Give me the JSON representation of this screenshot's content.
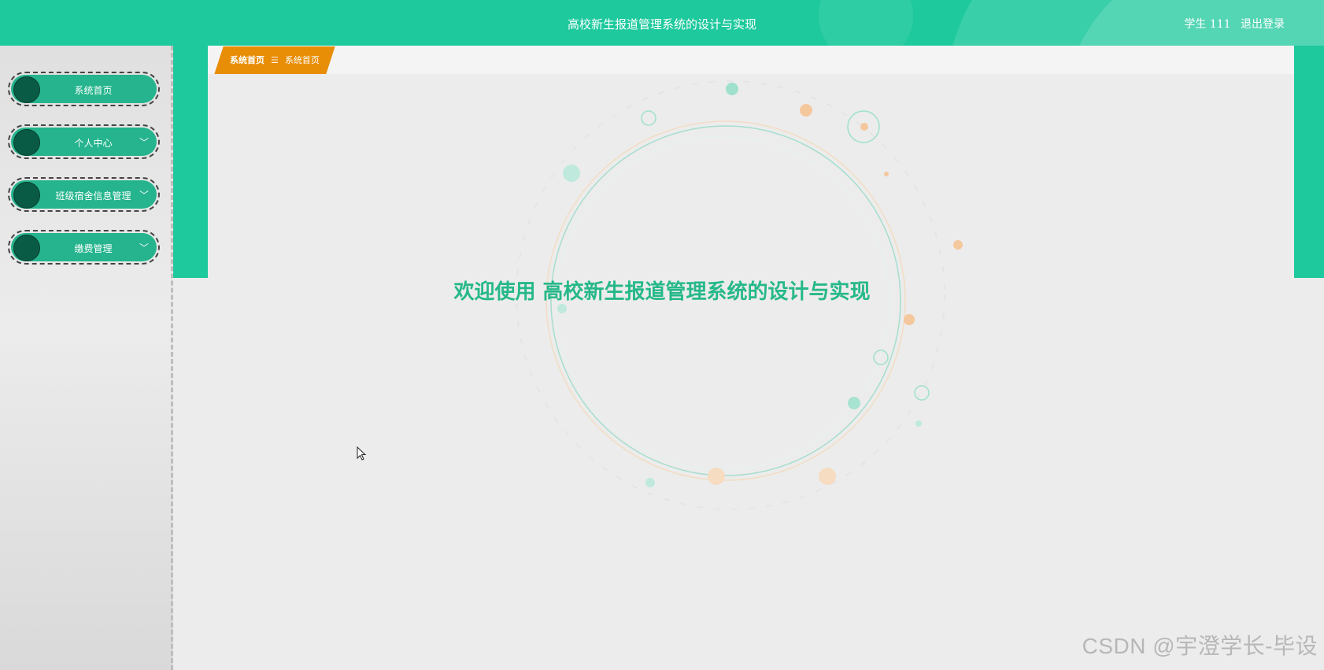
{
  "header": {
    "app_title": "高校新生报道管理系统的设计与实现",
    "user_label": "学生 111",
    "logout_label": "退出登录"
  },
  "sidebar": {
    "items": [
      {
        "label": "系统首页",
        "icon": "menu-circle-icon",
        "has_chevron": false
      },
      {
        "label": "个人中心",
        "icon": "menu-circle-icon",
        "has_chevron": true
      },
      {
        "label": "班级宿舍信息管理",
        "icon": "menu-circle-icon",
        "has_chevron": true
      },
      {
        "label": "缴费管理",
        "icon": "menu-circle-icon",
        "has_chevron": true
      }
    ],
    "chevron": "﹀"
  },
  "breadcrumb": {
    "home": "系统首页",
    "separator": "☰",
    "current": "系统首页"
  },
  "main": {
    "welcome_text": "欢迎使用 高校新生报道管理系统的设计与实现"
  },
  "watermark": "CSDN @宇澄学长-毕设",
  "colors": {
    "primary": "#1ec99d",
    "menu_item": "#25b48d",
    "menu_dot": "#0a5b45",
    "breadcrumb": "#e88d06",
    "welcome": "#26b889"
  }
}
